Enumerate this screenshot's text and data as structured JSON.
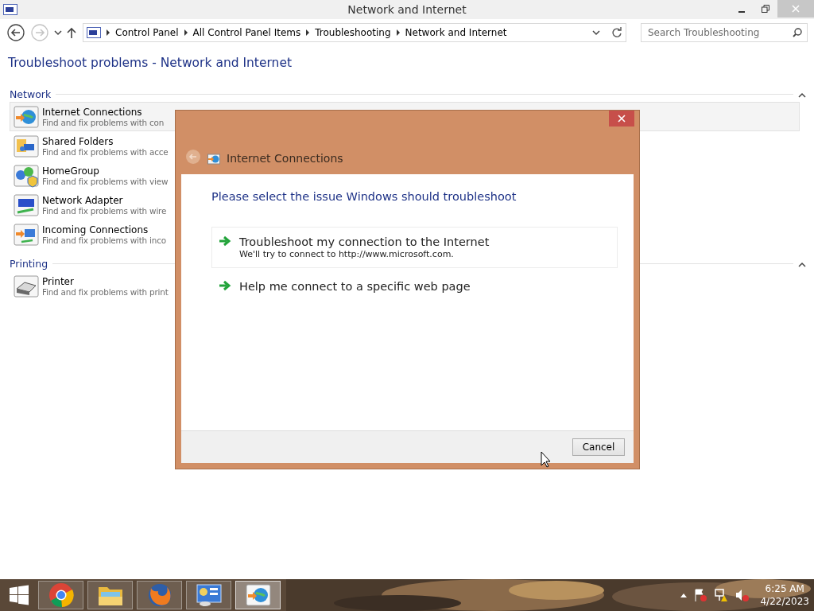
{
  "window": {
    "title": "Network and Internet"
  },
  "address_bar": {
    "path": [
      "Control Panel",
      "All Control Panel Items",
      "Troubleshooting",
      "Network and Internet"
    ]
  },
  "search": {
    "placeholder": "Search Troubleshooting"
  },
  "heading": "Troubleshoot problems - Network and Internet",
  "groups": [
    {
      "title": "Network",
      "expanded": true,
      "items": [
        {
          "kind": "internet",
          "name": "Internet Connections",
          "description": "Find and fix problems with con",
          "selected": true
        },
        {
          "kind": "folders",
          "name": "Shared Folders",
          "description": "Find and fix problems with acce",
          "selected": false
        },
        {
          "kind": "homegroup",
          "name": "HomeGroup",
          "description": "Find and fix problems with view",
          "selected": false
        },
        {
          "kind": "adapter",
          "name": "Network Adapter",
          "description": "Find and fix problems with wire",
          "selected": false
        },
        {
          "kind": "incoming",
          "name": "Incoming Connections",
          "description": "Find and fix problems with inco",
          "selected": false
        }
      ]
    },
    {
      "title": "Printing",
      "expanded": true,
      "items": [
        {
          "kind": "printer",
          "name": "Printer",
          "description": "Find and fix problems with print",
          "selected": false
        }
      ]
    }
  ],
  "dialog": {
    "title": "Internet Connections",
    "prompt": "Please select the issue Windows should troubleshoot",
    "options": [
      {
        "title": "Troubleshoot my connection to the Internet",
        "description": "We'll try to connect to http://www.microsoft.com.",
        "selected": true
      },
      {
        "title": "Help me connect to a specific web page",
        "selected": false
      }
    ],
    "buttons": [
      "Cancel"
    ]
  },
  "taskbar": {
    "apps": [
      {
        "kind": "chrome",
        "selected": false
      },
      {
        "kind": "explorer",
        "selected": false
      },
      {
        "kind": "firefox",
        "selected": false
      },
      {
        "kind": "control-panel",
        "selected": false
      },
      {
        "kind": "troubleshooter",
        "selected": true
      }
    ],
    "clock": {
      "time": "6:25 AM",
      "date": "4/22/2023"
    }
  }
}
